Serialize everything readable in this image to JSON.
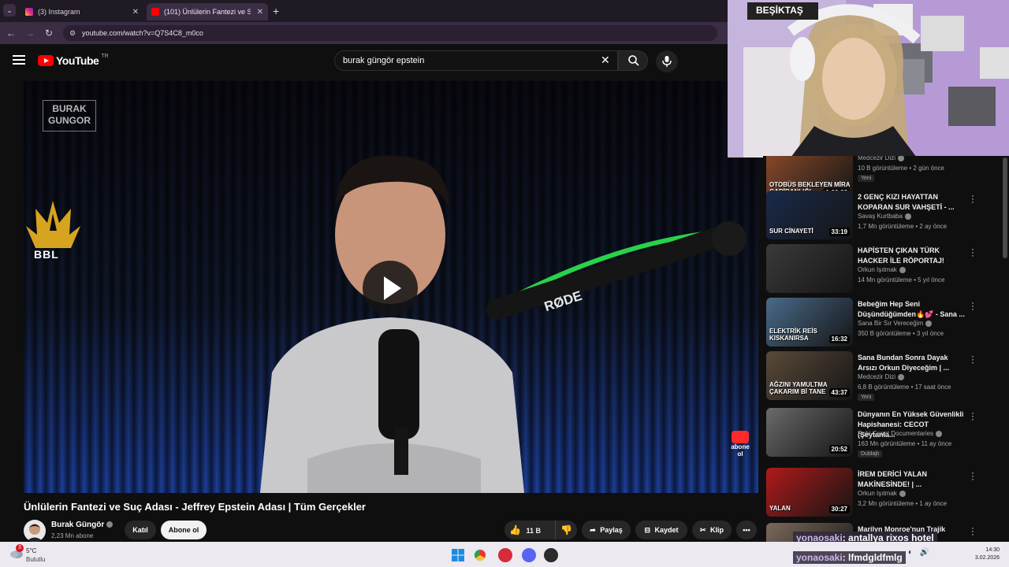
{
  "browser": {
    "tabs": [
      {
        "label": "(3) Instagram"
      },
      {
        "label": "(101) Ünlülerin Fantezi ve Suç A"
      }
    ],
    "url": "youtube.com/watch?v=Q7S4C8_m0co"
  },
  "youtube": {
    "logo_text": "YouTube",
    "country": "TR",
    "search_query": "burak güngör epstein"
  },
  "player": {
    "watermark": "BURAK GUNGOR",
    "badge_text": "BBL",
    "mic_brand": "RØDE",
    "subscribe_overlay": "abone ol"
  },
  "video": {
    "title": "Ünlülerin Fantezi ve Suç Adası - Jeffrey Epstein Adası | Tüm Gerçekler",
    "channel": "Burak Güngör",
    "subscribers": "2,23 Mn abone",
    "join_label": "Katıl",
    "subscribe_label": "Abone ol",
    "likes": "11 B",
    "share_label": "Paylaş",
    "save_label": "Kaydet",
    "clip_label": "Klip"
  },
  "recommendations": [
    {
      "title": "",
      "thumb_caption": "OTOBÜS BEKLEYEN MİRA GARİBANLIĞI",
      "duration": "1:00:06",
      "channel": "Medcezir Dizi",
      "meta": "10 B görüntüleme • 2 gün önce",
      "badge": "Yeni",
      "thumb_color": "#8a4a2a"
    },
    {
      "title": "2 GENÇ KIZI HAYATTAN KOPARAN SUR VAHŞETİ - ...",
      "thumb_caption": "SUR CİNAYETİ",
      "duration": "33:19",
      "channel": "Savaş Kurtbaba",
      "meta": "1,7 Mn görüntüleme • 2 ay önce",
      "badge": "",
      "thumb_color": "#1a2a4a"
    },
    {
      "title": "HAPİSTEN ÇIKAN TÜRK HACKER İLE RÖPORTAJ!",
      "thumb_caption": "",
      "duration": "",
      "channel": "Orkun Işıtmak",
      "meta": "14 Mn görüntüleme • 5 yıl önce",
      "badge": "",
      "thumb_color": "#3a3a3a"
    },
    {
      "title": "Bebeğim Hep Seni Düşündüğümden🔥💕 - Sana ...",
      "thumb_caption": "ELEKTRİK REİS KISKANIRSA",
      "duration": "16:32",
      "channel": "Sana Bir Sır Vereceğim",
      "meta": "350 B görüntüleme • 3 yıl önce",
      "badge": "",
      "thumb_color": "#4a6a8a"
    },
    {
      "title": "Sana Bundan Sonra Dayak Arsızı Orkun Diyeceğim | ...",
      "thumb_caption": "AĞZINI YAMULTMA ÇAKARIM Bİ TANE",
      "duration": "43:37",
      "channel": "Medcezir Dizi",
      "meta": "6,8 B görüntüleme • 17 saat önce",
      "badge": "Yeni",
      "thumb_color": "#5a4a3a"
    },
    {
      "title": "Dünyanın En Yüksek Güvenlikli Hapishanesi: CECOT (Şeytanla...",
      "thumb_caption": "",
      "duration": "20:52",
      "channel": "Ruhi Cenet Documentaries",
      "meta": "163 Mn görüntüleme • 11 ay önce",
      "badge": "Dublajlı",
      "thumb_color": "#6a6a6a"
    },
    {
      "title": "İREM DERİCİ YALAN MAKİNESİNDE! | ...",
      "thumb_caption": "YALAN",
      "duration": "30:27",
      "channel": "Orkun Işıtmak",
      "meta": "3,2 Mn görüntüleme • 1 ay önce",
      "badge": "",
      "thumb_color": "#b01a1a"
    },
    {
      "title": "Marilyn Monroe'nun Trajik",
      "thumb_caption": "",
      "duration": "",
      "channel": "",
      "meta": "",
      "badge": "",
      "thumb_color": "#7a6a5a"
    }
  ],
  "chat": [
    {
      "user": "yonaosaki",
      "message": ": antallya rixos hotel"
    },
    {
      "user": "yonaosaki",
      "message": ": lfmdgldfmlg"
    }
  ],
  "taskbar": {
    "weather_temp": "5°C",
    "weather_desc": "Bulutlu",
    "notification_count": "3",
    "time": "14:30",
    "date": "3.02.2026"
  },
  "webcam": {
    "banner_text": "BEŞİKTAŞ"
  }
}
